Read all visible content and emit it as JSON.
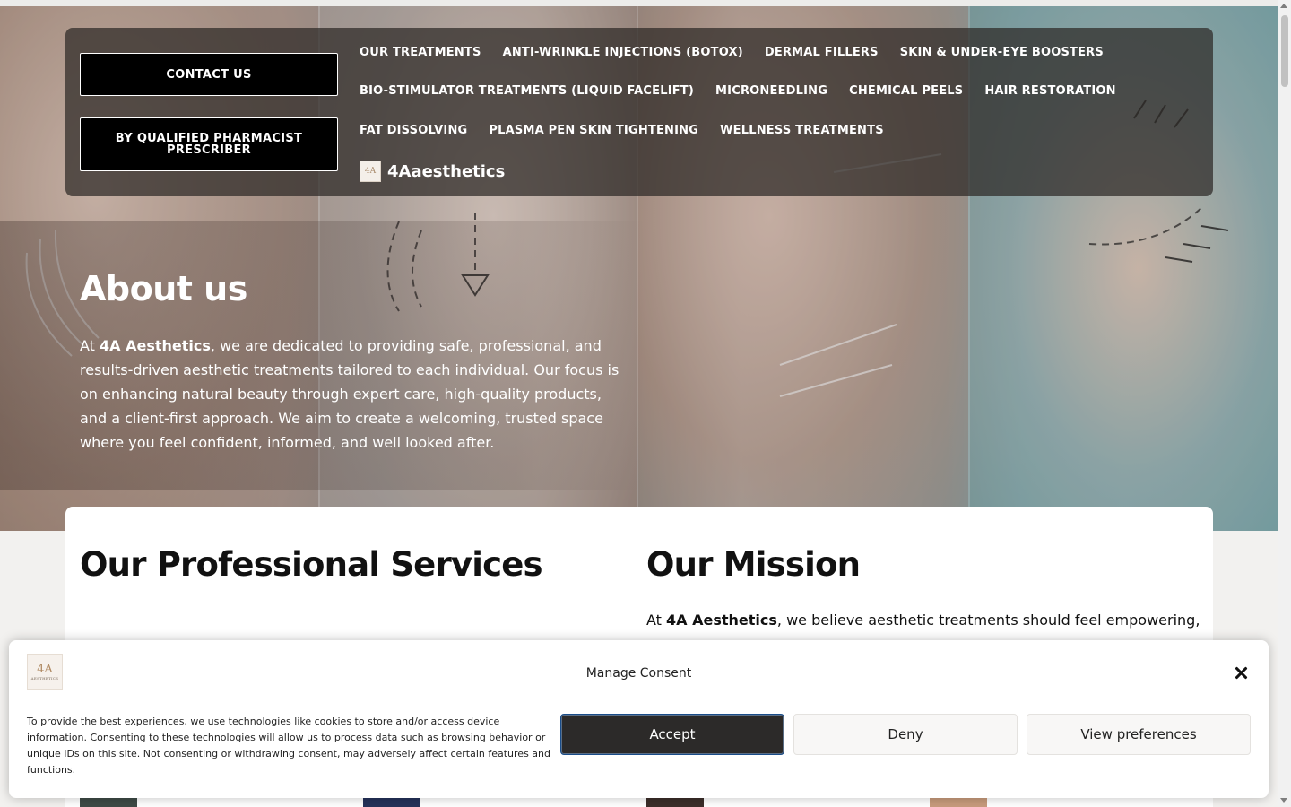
{
  "nav": {
    "contact_label": "CONTACT US",
    "pharmacist_label": "BY QUALIFIED PHARMACIST PRESCRIBER",
    "row1": [
      "OUR TREATMENTS",
      "ANTI-WRINKLE INJECTIONS (BOTOX)",
      "DERMAL FILLERS",
      "SKIN & UNDER-EYE BOOSTERS"
    ],
    "row2": [
      "BIO-STIMULATOR TREATMENTS (LIQUID FACELIFT)",
      "MICRONEEDLING",
      "CHEMICAL PEELS",
      "HAIR RESTORATION"
    ],
    "row3": [
      "FAT DISSOLVING",
      "PLASMA PEN SKIN TIGHTENING",
      "WELLNESS TREATMENTS"
    ],
    "brand_name": "4Aaesthetics",
    "brand_logo_text": "4A"
  },
  "hero": {
    "title": "About us",
    "text_prefix": "At ",
    "text_bold": "4A Aesthetics",
    "text_rest": ", we are dedicated to providing safe, professional, and results-driven aesthetic treatments tailored to each individual. Our focus is on enhancing natural beauty through expert care, high-quality products, and a client-first approach. We aim to create a welcoming, trusted space where you feel confident, informed, and well looked after."
  },
  "content": {
    "services_title": "Our Professional Services",
    "mission_title": "Our Mission",
    "mission_prefix": "At ",
    "mission_bold": "4A Aesthetics",
    "mission_rest": ", we believe aesthetic treatments should feel empowering,"
  },
  "consent": {
    "logo_big": "4A",
    "logo_small": "AESTHETICS",
    "title": "Manage Consent",
    "text": "To provide the best experiences, we use technologies like cookies to store and/or access device information. Consenting to these technologies will allow us to process data such as browsing behavior or unique IDs on this site. Not consenting or withdrawing consent, may adversely affect certain features and functions.",
    "accept_label": "Accept",
    "deny_label": "Deny",
    "prefs_label": "View preferences"
  },
  "colors": {
    "accent_dark": "#2c2a29",
    "nav_overlay": "#2d2826"
  }
}
